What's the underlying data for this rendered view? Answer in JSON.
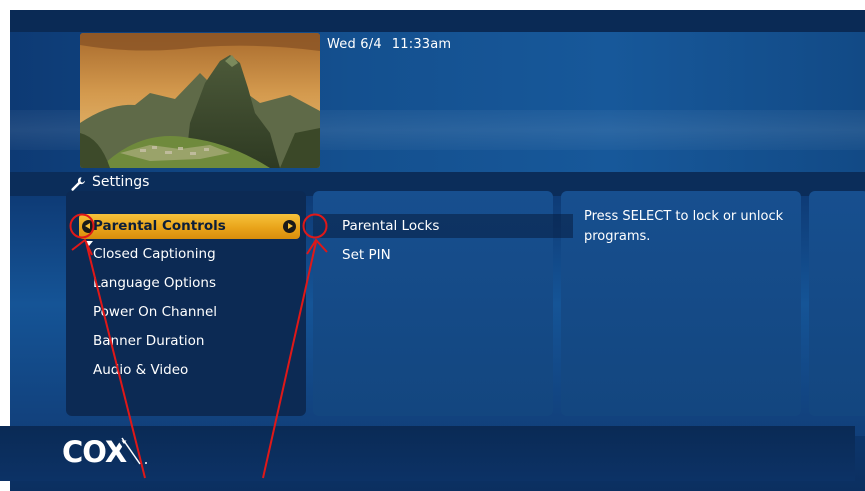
{
  "header": {
    "date": "Wed 6/4",
    "time": "11:33am"
  },
  "page": {
    "title": "Settings",
    "icon": "wrench-icon"
  },
  "menu": {
    "items": [
      {
        "label": "Parental Controls",
        "selected": true
      },
      {
        "label": "Closed Captioning",
        "selected": false
      },
      {
        "label": "Language Options",
        "selected": false
      },
      {
        "label": "Power On Channel",
        "selected": false
      },
      {
        "label": "Banner Duration",
        "selected": false
      },
      {
        "label": "Audio & Video",
        "selected": false
      }
    ]
  },
  "submenu": {
    "items": [
      {
        "label": "Parental Locks",
        "highlighted": true
      },
      {
        "label": "Set PIN",
        "highlighted": false
      }
    ]
  },
  "description": {
    "text": "Press SELECT to lock or unlock programs."
  },
  "brand": {
    "logo_text": "COX"
  },
  "colors": {
    "selection": "#f0b22a",
    "background": "#134a8a",
    "annotation": "#e01818"
  }
}
